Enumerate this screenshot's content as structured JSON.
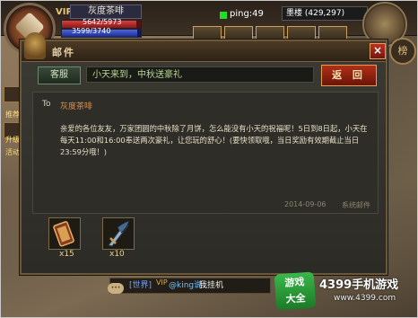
{
  "hud": {
    "vip": "VIP",
    "player_name": "灰度茶啡",
    "hp_text": "5642/5973",
    "hp_fraction": 0.94,
    "mp_text": "3599/3740",
    "mp_fraction": 0.96,
    "ping": "ping:49",
    "server": "墨楼 (429,297)"
  },
  "side": {
    "left_labels": [
      "推荐",
      "升级",
      "活动"
    ],
    "right_icon": "榜"
  },
  "mail": {
    "title": "邮件",
    "recipient_chip": "客服",
    "subject": "小天来到，中秋送豪礼",
    "back_button": "返 回",
    "close": "×",
    "to_label": "To",
    "to_name": "灰度茶啡",
    "body": "亲爱的各位友友，万家团圆的中秋除了月饼，怎么能没有小天的祝福呢！5日到8日起，小天在每天11:00和16:00奉送两次豪礼，让您玩的舒心！(要快领取哦，当日奖励有效期截止当日23:59分哦！)",
    "date": "2014-09-06",
    "sender": "系统邮件",
    "attachments": [
      {
        "icon": "scroll-icon",
        "qty": "x15"
      },
      {
        "icon": "sword-icon",
        "qty": "x10"
      }
    ]
  },
  "chat": {
    "channel": "[世界]",
    "vip": "VIP",
    "user": "@king说：",
    "message": "我挂机"
  },
  "watermark": {
    "logo_line1": "游戏",
    "logo_line2": "大全",
    "title": "4399手机游戏",
    "url": "www.4399.com"
  }
}
